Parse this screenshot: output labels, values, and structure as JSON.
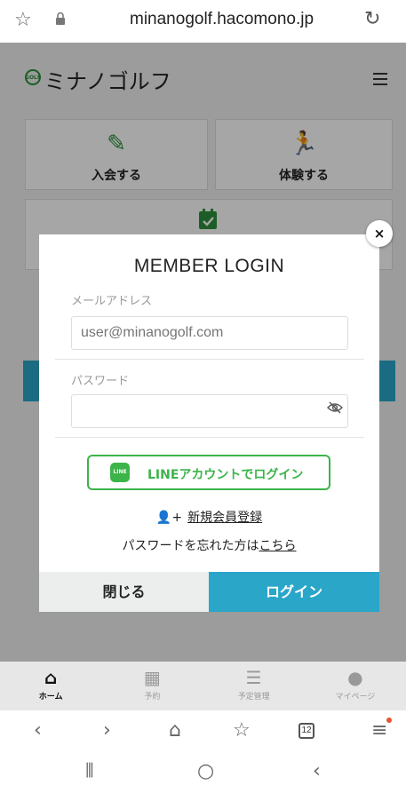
{
  "browser": {
    "url": "minanogolf.hacomono.jp",
    "tab_count": "12"
  },
  "app": {
    "logo_text": "ミナノゴルフ",
    "tiles": [
      {
        "label": "入会する",
        "icon": "pencil-icon"
      },
      {
        "label": "体験する",
        "icon": "running-icon"
      },
      {
        "label": "",
        "icon": "calendar-check-icon"
      }
    ]
  },
  "modal": {
    "title": "MEMBER LOGIN",
    "email_label": "メールアドレス",
    "email_placeholder": "user@minanogolf.com",
    "password_label": "パスワード",
    "password_value": "",
    "line_badge": "LINE",
    "line_button": "LINEアカウントでログイン",
    "register_link": "新規会員登録",
    "forgot_text": "パスワードを忘れた方は",
    "forgot_link": "こちら",
    "close_label": "閉じる",
    "login_label": "ログイン",
    "close_x": "×"
  },
  "bottom_nav": [
    {
      "label": "ホーム",
      "icon": "home-icon",
      "active": true
    },
    {
      "label": "予約",
      "icon": "calendar-icon",
      "active": false
    },
    {
      "label": "予定管理",
      "icon": "list-icon",
      "active": false
    },
    {
      "label": "マイページ",
      "icon": "user-icon",
      "active": false
    }
  ],
  "colors": {
    "accent": "#2aa6c9",
    "line_green": "#3cb44a",
    "brand_green": "#2c8f3c"
  }
}
